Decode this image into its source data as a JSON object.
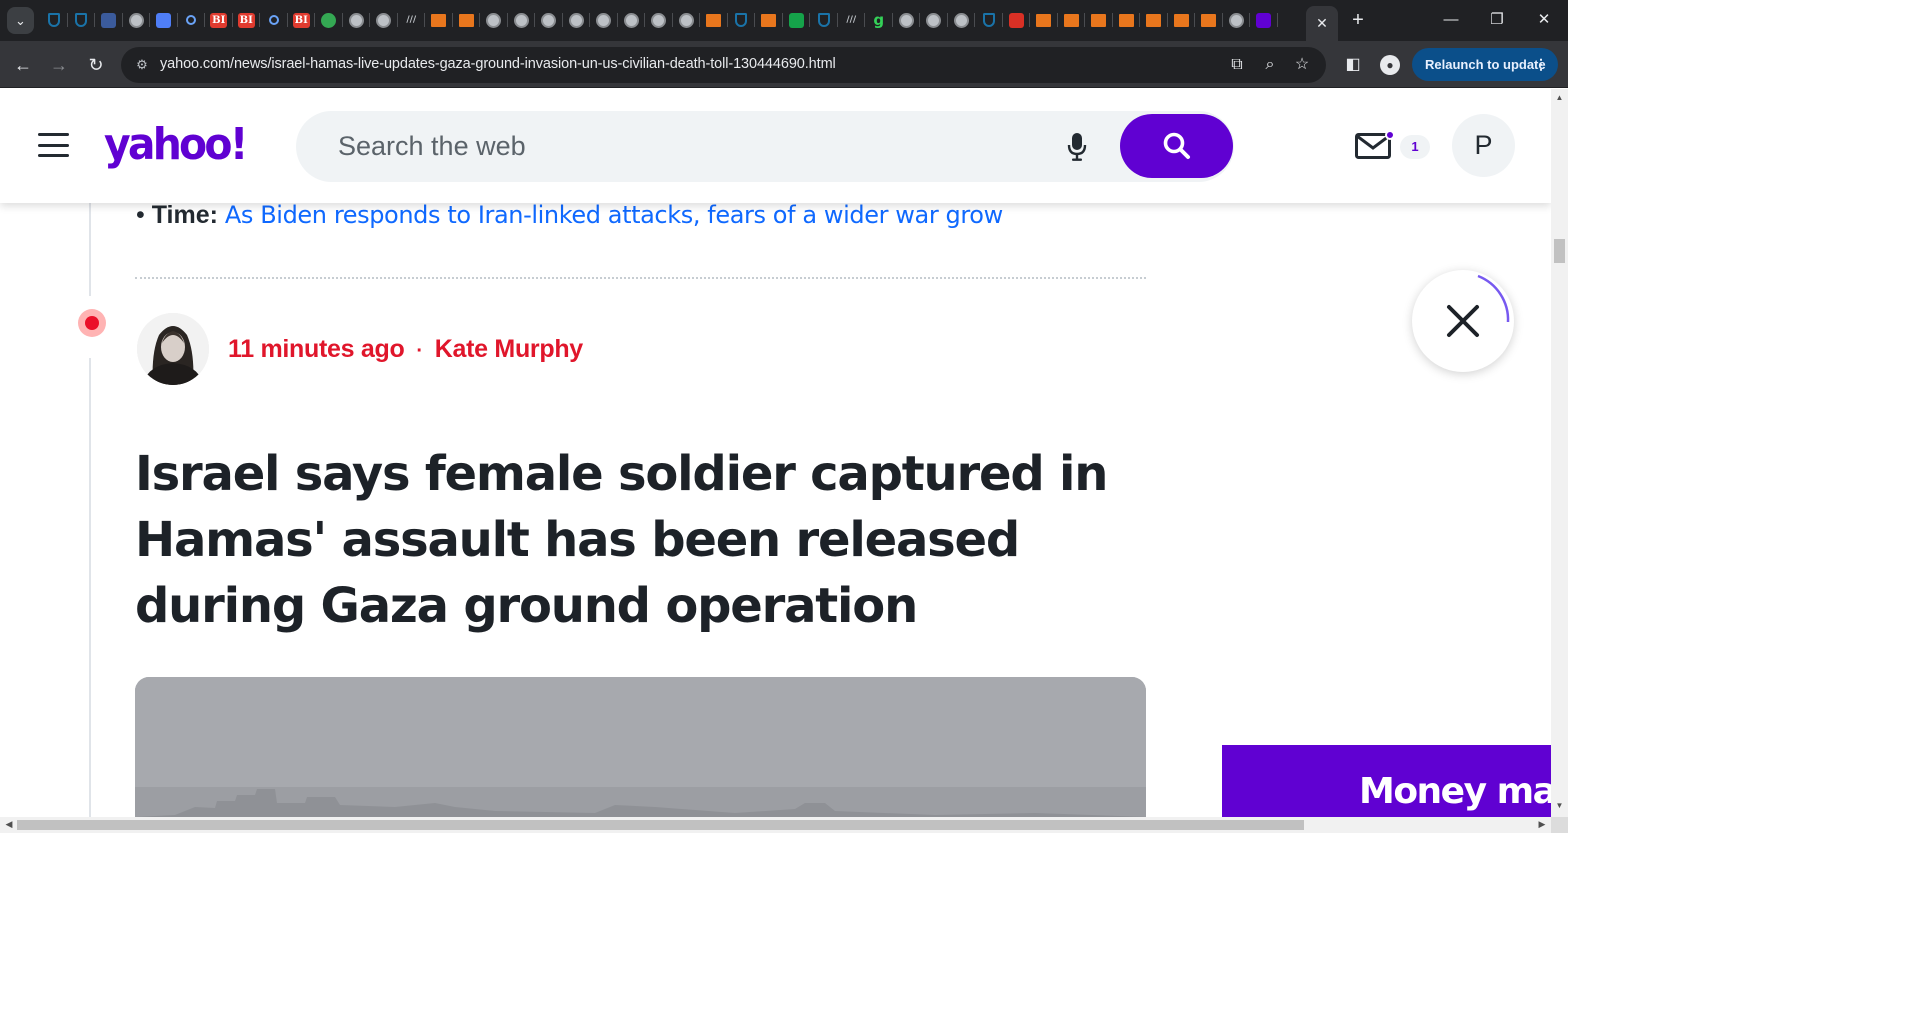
{
  "browser": {
    "tab_search_glyph": "⌄",
    "tab_icons": [
      "shield",
      "shield",
      "flag",
      "globe",
      "grad",
      "mag",
      "bi",
      "bi",
      "mag",
      "bi",
      "play",
      "globe",
      "globe",
      "slash",
      "bookmark",
      "bookmark",
      "globe",
      "globe",
      "globe",
      "globe",
      "globe",
      "globe",
      "globe",
      "globe",
      "bookmark",
      "shield",
      "bookmark",
      "green",
      "shield",
      "slash",
      "g",
      "globe",
      "globe",
      "globe",
      "shield",
      "red",
      "bookmark",
      "bookmark",
      "bookmark",
      "bookmark",
      "bookmark",
      "bookmark",
      "bookmark",
      "globe",
      "purple"
    ],
    "tab_icon_labels": {
      "bi": "BI",
      "g": "g",
      "slash": "///"
    },
    "active_tab_close": "✕",
    "new_tab": "+",
    "minimize": "—",
    "maximize": "❐",
    "close": "✕",
    "url": "yahoo.com/news/israel-hamas-live-updates-gaza-ground-invasion-un-us-civilian-death-toll-130444690.html",
    "relaunch_label": "Relaunch to update",
    "relaunch_menu": "⋮",
    "profile_initial": "●"
  },
  "header": {
    "logo": "yahoo!",
    "search_placeholder": "Search the web",
    "mail_count": "1",
    "avatar_initial": "P"
  },
  "article": {
    "bullet_source": "Time:",
    "bullet_link": "As Biden responds to Iran-linked attacks, fears of a wider war grow",
    "post_time": "11 minutes ago",
    "post_sep": "·",
    "author": "Kate Murphy",
    "headline": "Israel says female soldier captured in Hamas' assault has been released during Gaza ground operation"
  },
  "ad": {
    "text": "Money mar"
  },
  "colors": {
    "brand": "#6001d2",
    "link": "#0f69ff",
    "live_red": "#e0162b"
  }
}
